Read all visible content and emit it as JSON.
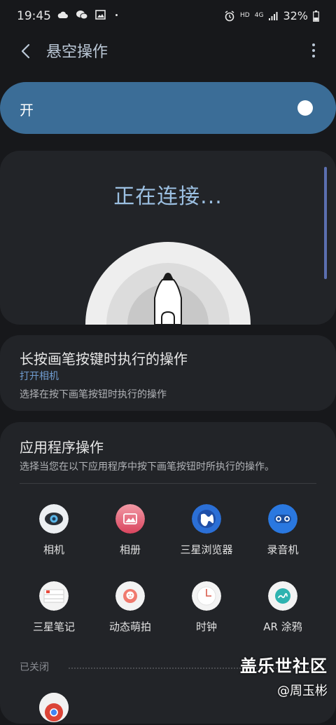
{
  "status": {
    "time": "19:45",
    "network": "HD",
    "net_type": "4G",
    "battery": "32%"
  },
  "header": {
    "title": "悬空操作"
  },
  "master": {
    "label": "开",
    "on": true
  },
  "connect": {
    "text": "正在连接..."
  },
  "long_press": {
    "title": "长按画笔按键时执行的操作",
    "value": "打开相机",
    "description": "选择在按下画笔按钮时执行的操作"
  },
  "apps": {
    "title": "应用程序操作",
    "description": "选择当您在以下应用程序中按下画笔按钮时所执行的操作。",
    "items": [
      {
        "label": "相机",
        "icon": "camera-icon"
      },
      {
        "label": "相册",
        "icon": "gallery-icon"
      },
      {
        "label": "三星浏览器",
        "icon": "internet-icon"
      },
      {
        "label": "录音机",
        "icon": "voice-recorder-icon"
      },
      {
        "label": "三星笔记",
        "icon": "notes-icon"
      },
      {
        "label": "动态萌拍",
        "icon": "ar-emoji-icon"
      },
      {
        "label": "时钟",
        "icon": "clock-icon"
      },
      {
        "label": "AR 涂鸦",
        "icon": "ar-doodle-icon"
      }
    ],
    "closed_label": "已关闭"
  },
  "watermark": {
    "line1": "盖乐世社区",
    "line2": "@周玉彬"
  }
}
